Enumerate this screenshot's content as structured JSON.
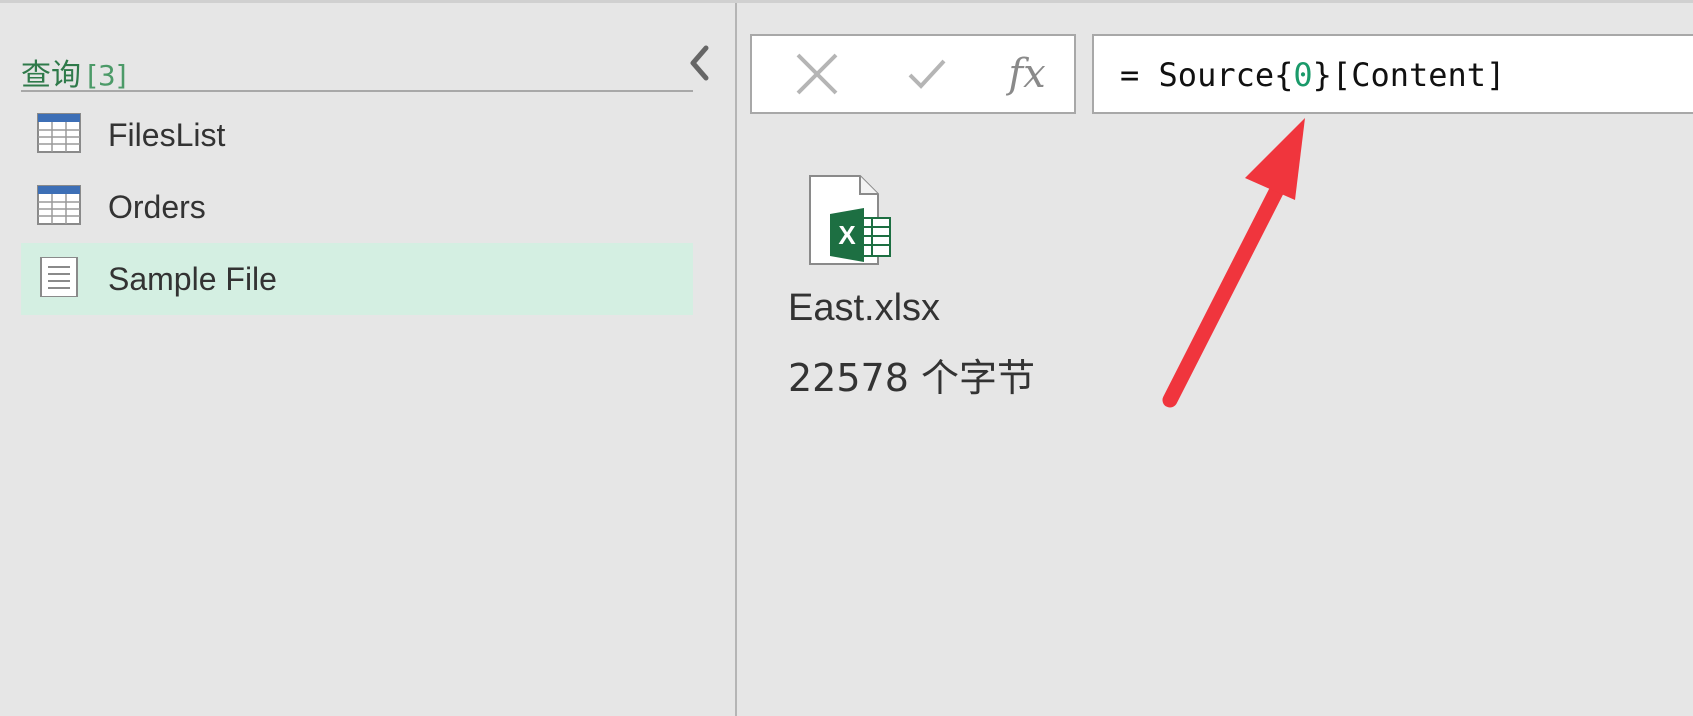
{
  "query_pane": {
    "title": "查询",
    "count": "[3]",
    "items": [
      {
        "label": "FilesList",
        "icon": "table-icon"
      },
      {
        "label": "Orders",
        "icon": "table-icon"
      },
      {
        "label": "Sample File",
        "icon": "document-icon",
        "selected": true
      }
    ]
  },
  "formula_bar": {
    "cancel_icon": "close-icon",
    "commit_icon": "checkmark-icon",
    "fx_label": "fx",
    "formula_prefix": "= Source{",
    "formula_index": "0",
    "formula_suffix": "}[Content]"
  },
  "preview": {
    "file_icon": "excel-file-icon",
    "file_name": "East.xlsx",
    "file_size": "22578 个字节"
  },
  "colors": {
    "accent_green": "#2f7a4a",
    "selected_bg": "#d4efe2",
    "annotation_red": "#f0353d",
    "excel_green": "#1d6f42"
  }
}
